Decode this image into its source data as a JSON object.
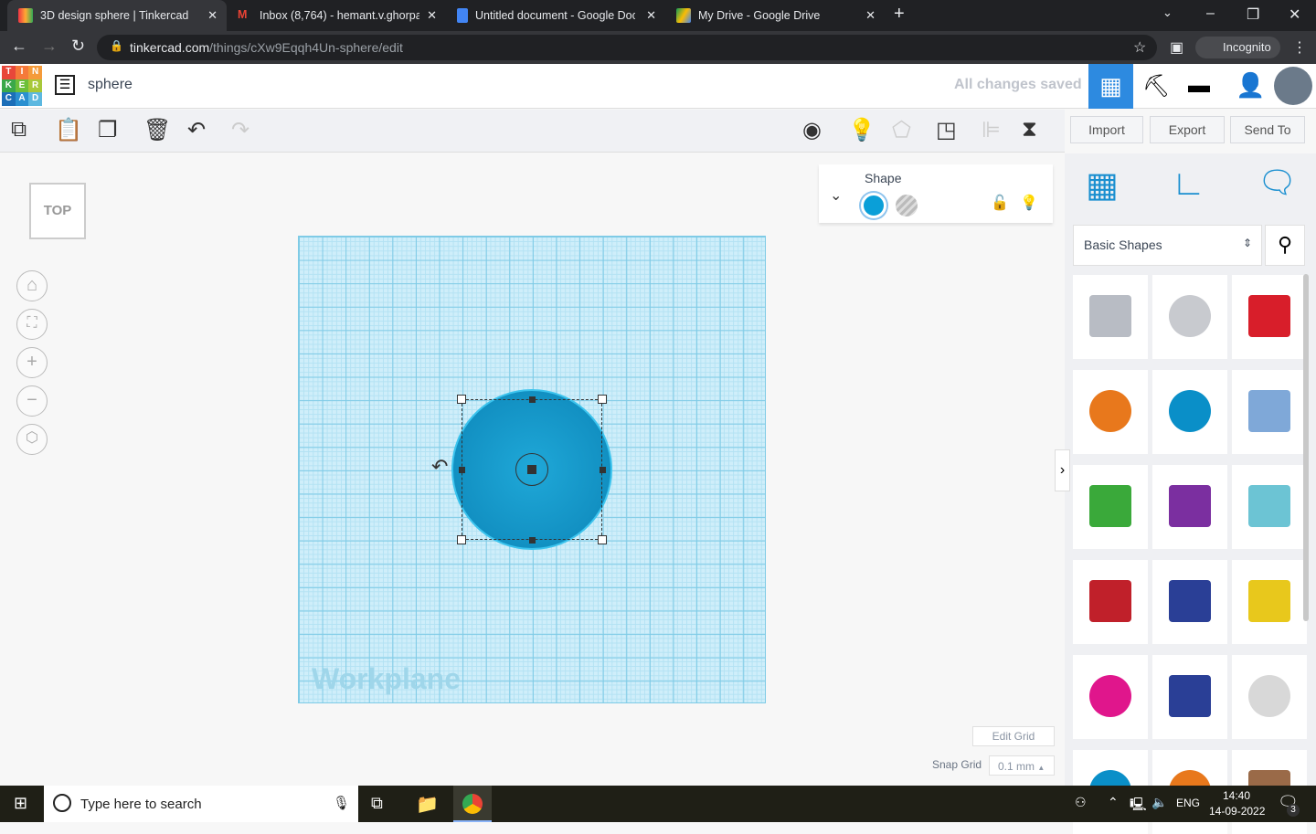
{
  "browser": {
    "tabs": [
      {
        "title": "3D design sphere | Tinkercad",
        "active": true
      },
      {
        "title": "Inbox (8,764) - hemant.v.ghorpade"
      },
      {
        "title": "Untitled document - Google Docs"
      },
      {
        "title": "My Drive - Google Drive"
      }
    ],
    "url_domain": "tinkercad.com",
    "url_path": "/things/cXw9Eqqh4Un-sphere/edit",
    "profile": "Incognito"
  },
  "app": {
    "logo": "TINKERCAD",
    "design_name": "sphere",
    "save_status": "All changes saved"
  },
  "toolbar": {
    "import": "Import",
    "export": "Export",
    "send_to": "Send To"
  },
  "viewcube": {
    "label": "TOP"
  },
  "workplane": {
    "label": "Workplane"
  },
  "inspector": {
    "title": "Shape",
    "solid_color": "#0a9fd8"
  },
  "library": {
    "category": "Basic Shapes",
    "shapes": [
      {
        "name": "box-hole",
        "color": "#b8bcc4"
      },
      {
        "name": "cylinder-hole",
        "color": "#c8cacf"
      },
      {
        "name": "box",
        "color": "#d81e2a"
      },
      {
        "name": "cylinder",
        "color": "#e8781c"
      },
      {
        "name": "sphere",
        "color": "#0a8fc8"
      },
      {
        "name": "scribble",
        "color": "#7fa8d8"
      },
      {
        "name": "roof",
        "color": "#3aa93a"
      },
      {
        "name": "cone",
        "color": "#7b2fa0"
      },
      {
        "name": "round-roof",
        "color": "#6cc4d4"
      },
      {
        "name": "text",
        "color": "#c0202a"
      },
      {
        "name": "polygon",
        "color": "#2a3f96"
      },
      {
        "name": "pyramid",
        "color": "#e8c81c"
      },
      {
        "name": "half-sphere",
        "color": "#e0168c"
      },
      {
        "name": "hexagonal-prism",
        "color": "#2a3f96"
      },
      {
        "name": "paraboloid",
        "color": "#d8d8d8"
      },
      {
        "name": "torus",
        "color": "#0a8fc8"
      },
      {
        "name": "tube",
        "color": "#e8781c"
      },
      {
        "name": "heart",
        "color": "#9a6a48"
      }
    ]
  },
  "grid": {
    "edit_grid": "Edit Grid",
    "snap_label": "Snap Grid",
    "snap_value": "0.1 mm"
  },
  "taskbar": {
    "search_placeholder": "Type here to search",
    "lang": "ENG",
    "time": "14:40",
    "date": "14-09-2022",
    "notifications": "3"
  }
}
